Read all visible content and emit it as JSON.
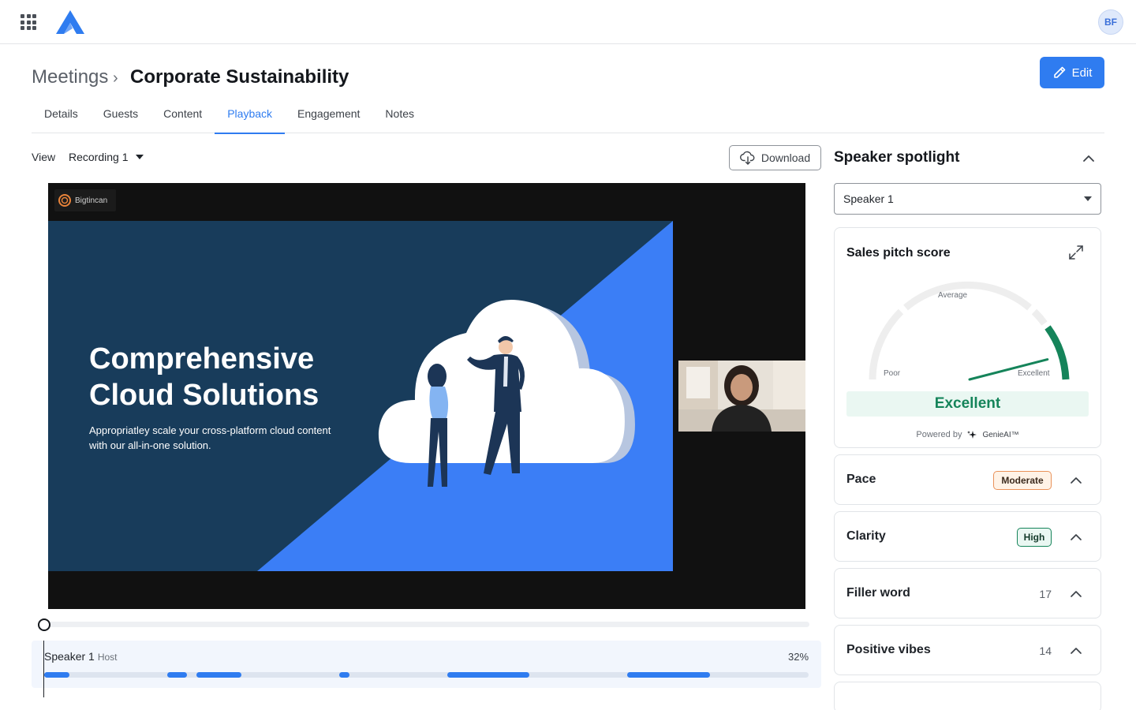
{
  "topbar": {
    "apps_icon": "grid-icon",
    "logo_icon": "brand-logo-icon",
    "avatar_initials": "BF"
  },
  "header": {
    "breadcrumb_root": "Meetings",
    "breadcrumb_separator": "›",
    "title": "Corporate Sustainability",
    "edit_label": "Edit"
  },
  "tabs": [
    {
      "label": "Details",
      "active": false
    },
    {
      "label": "Guests",
      "active": false
    },
    {
      "label": "Content",
      "active": false
    },
    {
      "label": "Playback",
      "active": true
    },
    {
      "label": "Engagement",
      "active": false
    },
    {
      "label": "Notes",
      "active": false
    }
  ],
  "view": {
    "label": "View",
    "recording": "Recording 1",
    "download_label": "Download"
  },
  "player": {
    "brand_chip": "Bigtincan",
    "slide_title": "Comprehensive Cloud Solutions",
    "slide_subtitle": "Appropriatley scale your cross-platform cloud content with our all-in-one solution.",
    "playhead_fraction": 0
  },
  "speaker_track": {
    "name": "Speaker 1",
    "role": "Host",
    "percent": "32%",
    "segments": [
      {
        "start": 0.0,
        "end": 0.033
      },
      {
        "start": 0.161,
        "end": 0.187
      },
      {
        "start": 0.199,
        "end": 0.258
      },
      {
        "start": 0.386,
        "end": 0.399
      },
      {
        "start": 0.527,
        "end": 0.635
      },
      {
        "start": 0.763,
        "end": 0.871
      }
    ]
  },
  "spotlight": {
    "title": "Speaker spotlight",
    "speaker_select": "Speaker 1",
    "score_card": {
      "title": "Sales pitch score",
      "label_average": "Average",
      "label_poor": "Poor",
      "label_excellent": "Excellent",
      "result": "Excellent",
      "powered_by": "Powered by",
      "provider": "GenieAI™",
      "gauge_value": 0.92,
      "accent_color": "#15845a"
    },
    "metrics": [
      {
        "label": "Pace",
        "badge": "Moderate",
        "type": "badge-moderate"
      },
      {
        "label": "Clarity",
        "badge": "High",
        "type": "badge-high"
      },
      {
        "label": "Filler word",
        "count": "17"
      },
      {
        "label": "Positive vibes",
        "count": "14"
      }
    ]
  },
  "colors": {
    "accent": "#2f7cf0",
    "success": "#15845a",
    "warning": "#e9925a"
  }
}
